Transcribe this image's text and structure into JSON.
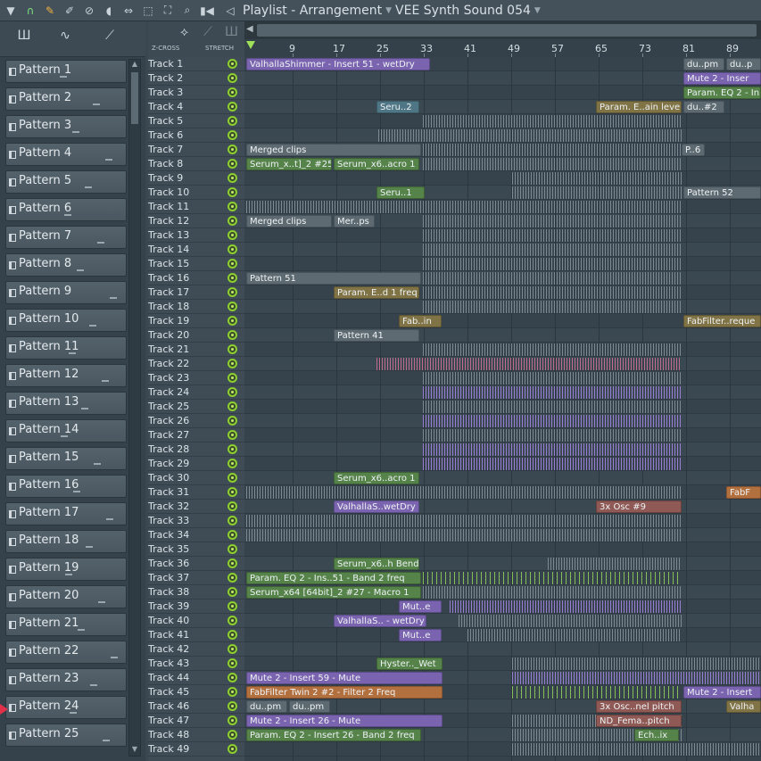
{
  "window": {
    "title": "Playlist - Arrangement",
    "project": "VEE Synth Sound 054"
  },
  "toolbar": {
    "icons": [
      "menu-arrow-icon",
      "magnet-icon",
      "pencil-icon",
      "paint-icon",
      "delete-icon",
      "mute-icon",
      "slip-icon",
      "select-icon",
      "zoom-icon",
      "playback-icon",
      "speaker-icon"
    ]
  },
  "side_tools": {
    "zcross_label": "Z-CROSS",
    "stretch_label": "STRETCH"
  },
  "timeline": {
    "bars": [
      "9",
      "17",
      "25",
      "33",
      "41",
      "49",
      "57",
      "65",
      "73",
      "81",
      "89"
    ]
  },
  "patterns": [
    "Pattern 1",
    "Pattern 2",
    "Pattern 3",
    "Pattern 4",
    "Pattern 5",
    "Pattern 6",
    "Pattern 7",
    "Pattern 8",
    "Pattern 9",
    "Pattern 10",
    "Pattern 11",
    "Pattern 12",
    "Pattern 13",
    "Pattern 14",
    "Pattern 15",
    "Pattern 16",
    "Pattern 17",
    "Pattern 18",
    "Pattern 19",
    "Pattern 20",
    "Pattern 21",
    "Pattern 22",
    "Pattern 23",
    "Pattern 24",
    "Pattern 25"
  ],
  "selected_pattern": "Pattern 24",
  "tracks": [
    "Track 1",
    "Track 2",
    "Track 3",
    "Track 4",
    "Track 5",
    "Track 6",
    "Track 7",
    "Track 8",
    "Track 9",
    "Track 10",
    "Track 11",
    "Track 12",
    "Track 13",
    "Track 14",
    "Track 15",
    "Track 16",
    "Track 17",
    "Track 18",
    "Track 19",
    "Track 20",
    "Track 21",
    "Track 22",
    "Track 23",
    "Track 24",
    "Track 25",
    "Track 26",
    "Track 27",
    "Track 28",
    "Track 29",
    "Track 30",
    "Track 31",
    "Track 32",
    "Track 33",
    "Track 34",
    "Track 35",
    "Track 36",
    "Track 37",
    "Track 38",
    "Track 39",
    "Track 40",
    "Track 41",
    "Track 42",
    "Track 43",
    "Track 44",
    "Track 45",
    "Track 46",
    "Track 47",
    "Track 48",
    "Track 49"
  ],
  "clips": {
    "t1a": "ValhallaShimmer - Insert 51 - wetDry",
    "t1b": "du..pm",
    "t1c": "du..p",
    "t2a": "Mute 2 - Inser",
    "t3a": "Param. EQ 2 - In",
    "t4a": "Seru..2",
    "t4b": "Param. E..ain level",
    "t4c": "du..#2",
    "t7a": "Merged clips",
    "t7b": "P..6",
    "t8a": "Serum_x..t]_2 #25",
    "t8b": "Serum_x6..acro 1",
    "t10a": "Seru..1",
    "t10b": "Pattern 52",
    "t12a": "Merged clips",
    "t12b": "Mer..ps",
    "t16a": "Pattern 51",
    "t17a": "Param. E..d 1 freq",
    "t19a": "Fab..in",
    "t19b": "FabFilter..reque",
    "t20a": "Pattern 41",
    "t30a": "Serum_x6..acro 1",
    "t31a": "FabF",
    "t32a": "ValhallaS..wetDry",
    "t32b": "3x Osc #9",
    "t36a": "Serum_x6..h Bend",
    "t37a": "Param. EQ 2 - Ins..51 - Band 2 freq",
    "t38a": "Serum_x64 [64bit]_2 #27 - Macro 1",
    "t39a": "Mut..e",
    "t40a": "ValhallaS.. - wetDry",
    "t41a": "Mut..e",
    "t43a": "Hyster.._Wet",
    "t44a": "Mute 2 - Insert 59 - Mute",
    "t45a": "FabFilter Twin 2 #2 - Filter 2 Freq",
    "t45b": "Mute 2 - Insert",
    "t46a": "du..pm",
    "t46b": "du..pm",
    "t46c": "3x Osc..nel pitch",
    "t46d": "Valha",
    "t47a": "Mute 2 - Insert 26 - Mute",
    "t47b": "ND_Fema..pitch",
    "t48a": "Param. EQ 2 - Insert 26 - Band 2 freq",
    "t48b": "Ech..ix"
  }
}
